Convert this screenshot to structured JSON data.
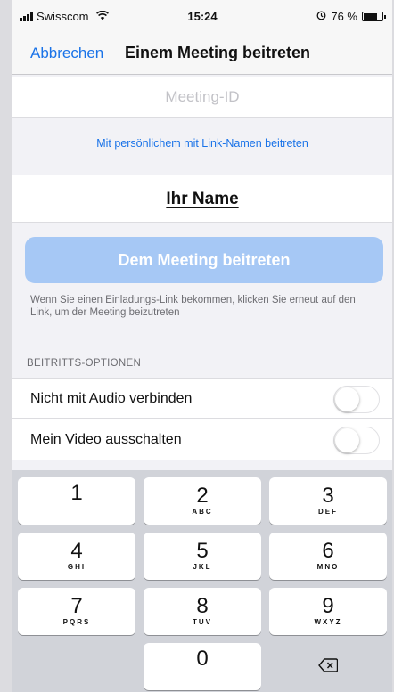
{
  "status_bar": {
    "carrier": "Swisscom",
    "time": "15:24",
    "battery": "76 %",
    "battery_level": 0.76,
    "icons": [
      "signal-icon",
      "wifi-icon",
      "alarm-icon",
      "battery-icon"
    ]
  },
  "nav": {
    "cancel_label": "Abbrechen",
    "title": "Einem Meeting beitreten"
  },
  "meeting_id": {
    "placeholder": "Meeting-ID",
    "value": ""
  },
  "link_join_label": "Mit persönlichem mit Link-Namen beitreten",
  "name_field": {
    "value": "Ihr Name"
  },
  "join_button": {
    "label": "Dem Meeting beitreten",
    "enabled": false,
    "color": "#a6c8f5"
  },
  "hint_text": "Wenn Sie einen Einladungs-Link bekommen, klicken Sie erneut auf den Link, um der Meeting beizutreten",
  "options": {
    "header": "BEITRITTS-OPTIONEN",
    "items": [
      {
        "label": "Nicht mit Audio verbinden",
        "on": false
      },
      {
        "label": "Mein Video ausschalten",
        "on": false
      }
    ]
  },
  "keypad": {
    "keys": [
      {
        "num": "1",
        "letters": ""
      },
      {
        "num": "2",
        "letters": "ABC"
      },
      {
        "num": "3",
        "letters": "DEF"
      },
      {
        "num": "4",
        "letters": "GHI"
      },
      {
        "num": "5",
        "letters": "JKL"
      },
      {
        "num": "6",
        "letters": "MNO"
      },
      {
        "num": "7",
        "letters": "PQRS"
      },
      {
        "num": "8",
        "letters": "TUV"
      },
      {
        "num": "9",
        "letters": "WXYZ"
      },
      {
        "num": "0",
        "letters": ""
      }
    ],
    "delete_icon": "backspace-icon"
  },
  "colors": {
    "accent": "#1a73e8",
    "background": "#f2f2f6",
    "keypad_background": "#d1d3d9"
  }
}
